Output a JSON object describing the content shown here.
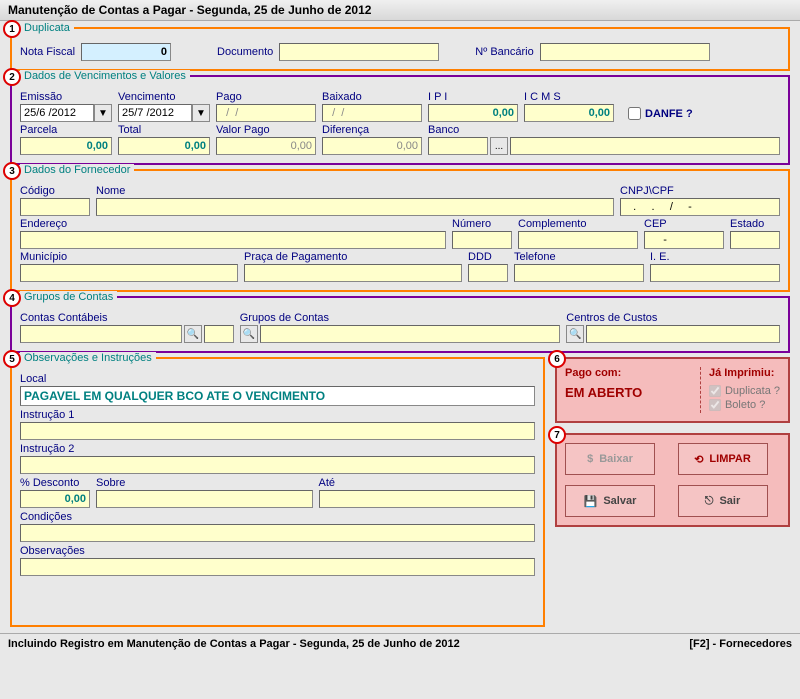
{
  "title": "Manutenção de Contas a Pagar - Segunda, 25 de Junho de 2012",
  "g1": {
    "legend": "Duplicata",
    "nota_fiscal_lbl": "Nota Fiscal",
    "nota_fiscal": "0",
    "documento_lbl": "Documento",
    "documento": "",
    "nbancario_lbl": "Nº Bancário",
    "nbancario": ""
  },
  "g2": {
    "legend": "Dados de Vencimentos e Valores",
    "emissao_lbl": "Emissão",
    "emissao": "25/6 /2012",
    "vencimento_lbl": "Vencimento",
    "vencimento": "25/7 /2012",
    "pago_lbl": "Pago",
    "pago": "  /  /",
    "baixado_lbl": "Baixado",
    "baixado": "  /  /",
    "ipi_lbl": "I P I",
    "ipi": "0,00",
    "icms_lbl": "I C M S",
    "icms": "0,00",
    "danfe_lbl": "DANFE ?",
    "parcela_lbl": "Parcela",
    "parcela": "0,00",
    "total_lbl": "Total",
    "total": "0,00",
    "vpago_lbl": "Valor Pago",
    "vpago": "0,00",
    "dif_lbl": "Diferença",
    "dif": "0,00",
    "banco_lbl": "Banco",
    "banco": "",
    "banco_desc": ""
  },
  "g3": {
    "legend": "Dados do Fornecedor",
    "codigo_lbl": "Código",
    "codigo": "",
    "nome_lbl": "Nome",
    "nome": "",
    "cnpj_lbl": "CNPJ\\CPF",
    "cnpj": "   .     .     /     -",
    "endereco_lbl": "Endereço",
    "endereco": "",
    "numero_lbl": "Número",
    "numero": "",
    "compl_lbl": "Complemento",
    "compl": "",
    "cep_lbl": "CEP",
    "cep": "     -",
    "estado_lbl": "Estado",
    "estado": "",
    "mun_lbl": "Município",
    "mun": "",
    "praca_lbl": "Praça de Pagamento",
    "praca": "",
    "ddd_lbl": "DDD",
    "ddd": "",
    "tel_lbl": "Telefone",
    "tel": "",
    "ie_lbl": "I. E.",
    "ie": ""
  },
  "g4": {
    "legend": "Grupos de Contas",
    "cc_lbl": "Contas Contábeis",
    "cc": "",
    "cc2": "",
    "gc_lbl": "Grupos de Contas",
    "gc": "",
    "gc2": "",
    "cdc_lbl": "Centros de Custos",
    "cdc": "",
    "cdc2": ""
  },
  "g5": {
    "legend": "Observações e Instruções",
    "local_lbl": "Local",
    "local": "PAGAVEL EM QUALQUER BCO ATE O VENCIMENTO",
    "i1_lbl": "Instrução 1",
    "i1": "",
    "i2_lbl": "Instrução 2",
    "i2": "",
    "desc_lbl": "% Desconto",
    "desc": "0,00",
    "sobre_lbl": "Sobre",
    "sobre": "",
    "ate_lbl": "Até",
    "ate": "",
    "cond_lbl": "Condições",
    "cond": "",
    "obs_lbl": "Observações",
    "obs": ""
  },
  "g6": {
    "pago_head": "Pago com:",
    "pago_status": "EM ABERTO",
    "imp_head": "Já Imprimiu:",
    "dup": "Duplicata ?",
    "bol": "Boleto ?"
  },
  "g7": {
    "baixar": "Baixar",
    "limpar": "LIMPAR",
    "salvar": "Salvar",
    "sair": "Sair"
  },
  "status": {
    "left": "Incluindo Registro em Manutenção de Contas a Pagar - Segunda, 25 de Junho de 2012",
    "right": "[F2] - Fornecedores"
  }
}
